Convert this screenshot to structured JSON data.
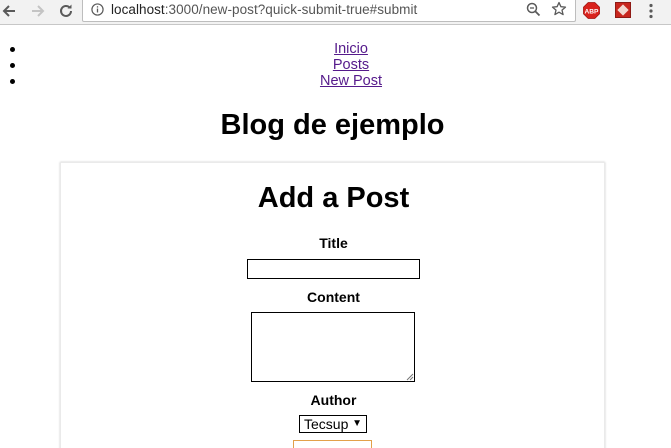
{
  "browser": {
    "url_host": "localhost",
    "url_rest": ":3000/new-post?quick-submit-true#submit",
    "icons": {
      "back": "arrow-left-icon",
      "forward": "arrow-right-icon",
      "reload": "reload-icon",
      "info": "info-icon",
      "zoom": "zoom-icon",
      "bookmark": "star-icon",
      "adblock": "abp-icon",
      "extension": "extension-icon",
      "menu": "more-vert-icon"
    },
    "abp_label": "ABP"
  },
  "nav": {
    "items": [
      {
        "label": "Inicio"
      },
      {
        "label": "Posts"
      },
      {
        "label": "New Post"
      }
    ]
  },
  "site": {
    "title": "Blog de ejemplo"
  },
  "form": {
    "heading": "Add a Post",
    "title_label": "Title",
    "title_value": "",
    "content_label": "Content",
    "content_value": "",
    "author_label": "Author",
    "author_selected": "Tecsup",
    "submit_label": ""
  },
  "colors": {
    "link_visited": "#551a8b",
    "submit_border": "#e3a04a",
    "abp_red": "#d9221c"
  }
}
